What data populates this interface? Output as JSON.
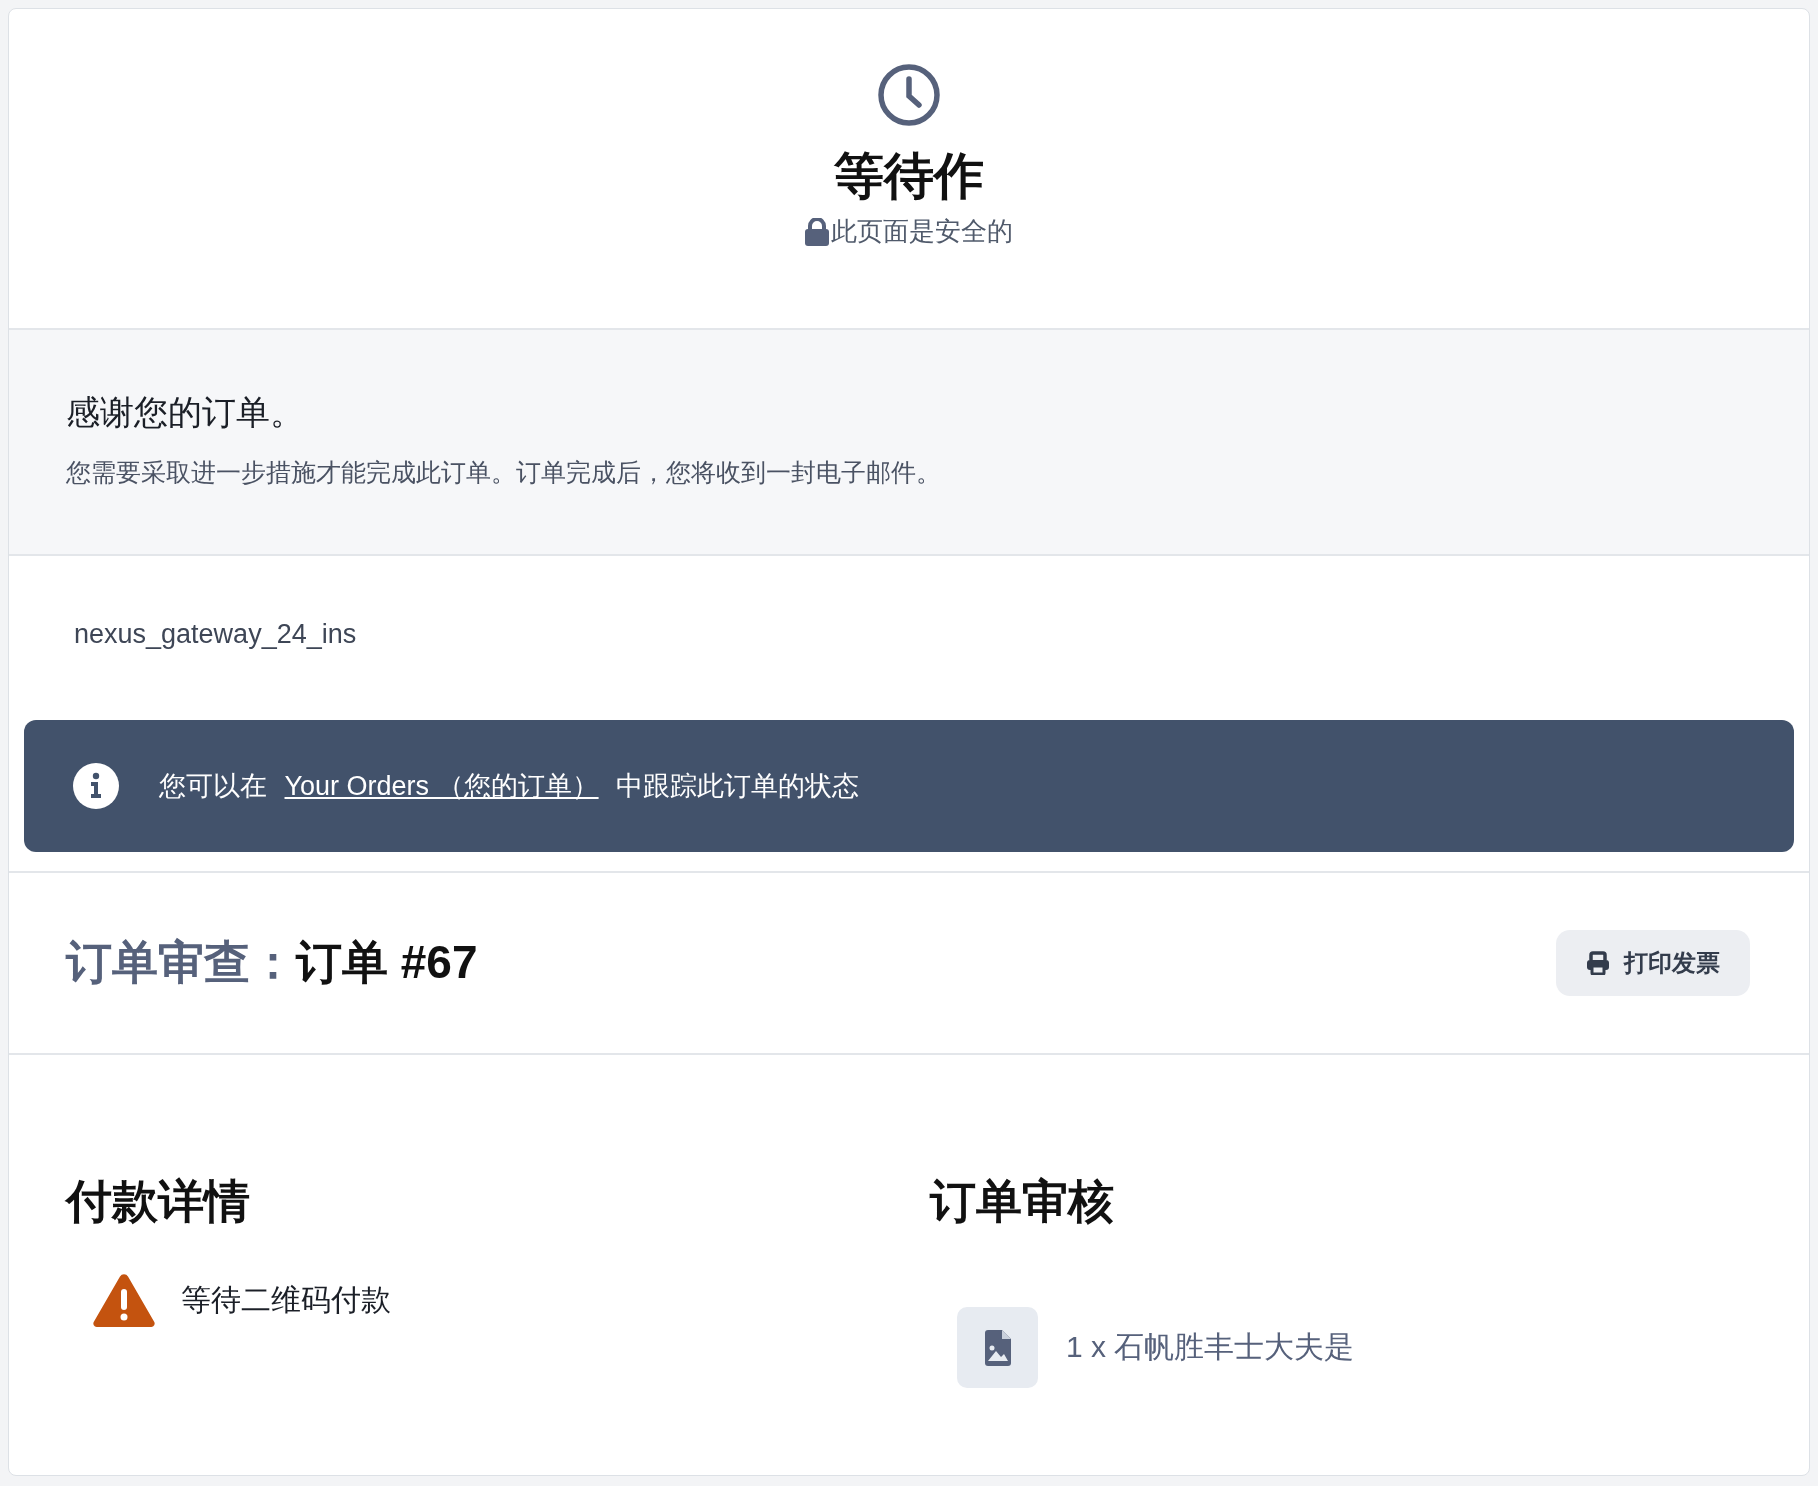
{
  "header": {
    "title": "等待作",
    "subtitle": "此页面是安全的"
  },
  "thanks": {
    "heading": "感谢您的订单。",
    "message": "您需要采取进一步措施才能完成此订单。订单完成后，您将收到一封电子邮件。"
  },
  "gateway": "nexus_gateway_24_ins",
  "banner": {
    "before": "您可以在",
    "link": "Your Orders （您的订单）",
    "after": "中跟踪此订单的状态"
  },
  "order_review": {
    "label": "订单审查：",
    "order": "订单 #67",
    "print_button": "打印发票"
  },
  "payment_details": {
    "heading": "付款详情",
    "status": "等待二维码付款"
  },
  "order_summary": {
    "heading": "订单审核",
    "items": [
      {
        "text": "1 x 石帆胜丰士大夫是"
      }
    ]
  }
}
